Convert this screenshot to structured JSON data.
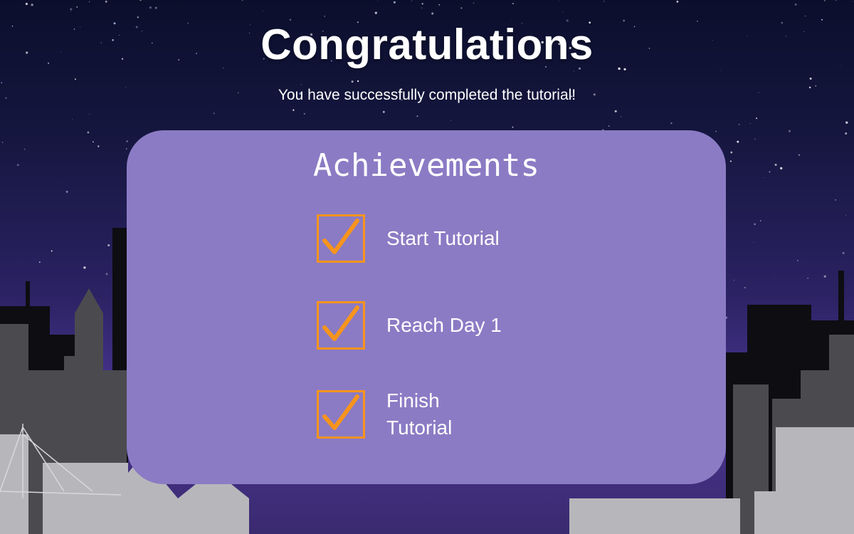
{
  "screen": {
    "title": "Congratulations",
    "subtitle": "You have successfully completed the tutorial!"
  },
  "achievements": {
    "heading": "Achievements",
    "items": [
      {
        "label": "Start Tutorial",
        "completed": true,
        "icon": "checkmark-icon"
      },
      {
        "label": "Reach Day 1",
        "completed": true,
        "icon": "checkmark-icon"
      },
      {
        "label": "Finish Tutorial",
        "completed": true,
        "icon": "checkmark-icon"
      }
    ]
  },
  "colors": {
    "panel": "#8b7bc4",
    "checkmark": "#f7941d",
    "text": "#ffffff",
    "sky_top": "#0b0f2c",
    "sky_bottom": "#4a3591"
  }
}
